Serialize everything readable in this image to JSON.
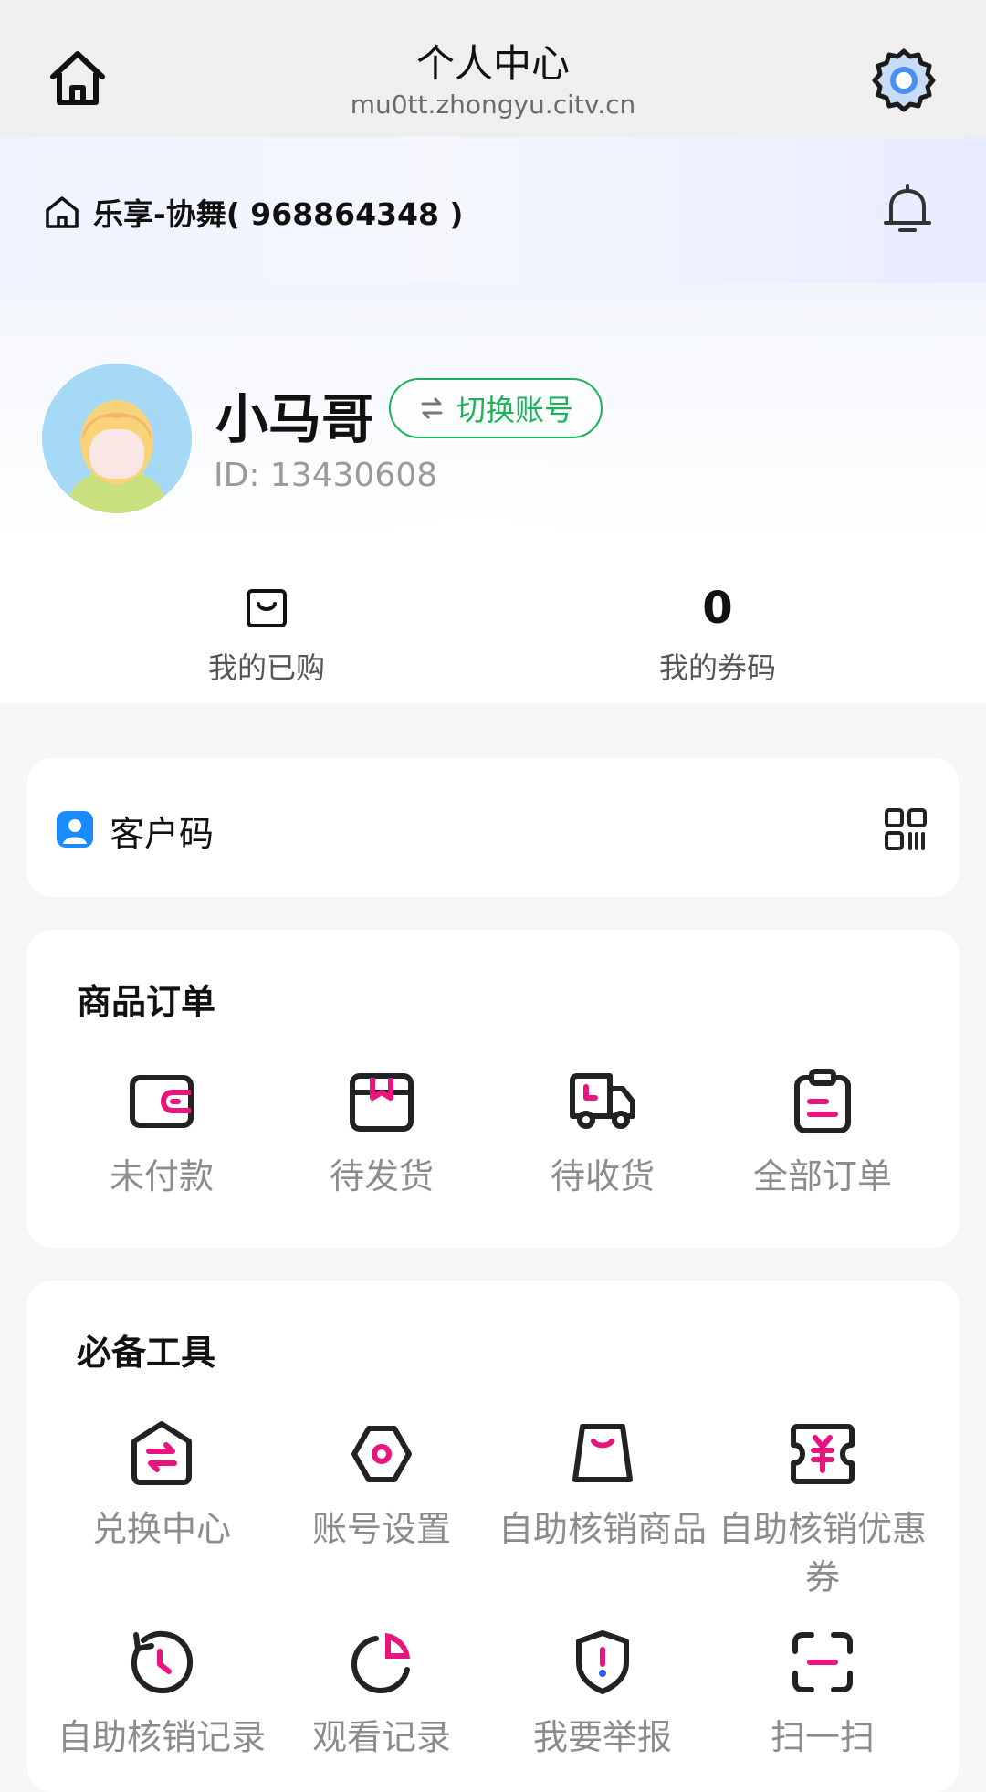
{
  "appbar": {
    "title": "个人中心",
    "url": "mu0tt.zhongyu.citv.cn"
  },
  "store": {
    "label": "乐享-协舞( 968864348 )"
  },
  "profile": {
    "name": "小马哥",
    "switch_label": "切换账号",
    "id_text": "ID: 13430608"
  },
  "stats": [
    {
      "value": "",
      "label": "我的已购",
      "icon": "bag-icon"
    },
    {
      "value": "0",
      "label": "我的券码"
    }
  ],
  "customer_code": {
    "label": "客户码"
  },
  "orders": {
    "title": "商品订单",
    "items": [
      {
        "label": "未付款",
        "icon": "wallet-icon"
      },
      {
        "label": "待发货",
        "icon": "box-icon"
      },
      {
        "label": "待收货",
        "icon": "truck-icon"
      },
      {
        "label": "全部订单",
        "icon": "clipboard-icon"
      }
    ]
  },
  "tools": {
    "title": "必备工具",
    "items": [
      {
        "label": "兑换中心",
        "icon": "exchange-icon"
      },
      {
        "label": "账号设置",
        "icon": "hexagon-settings-icon"
      },
      {
        "label": "自助核销商品",
        "icon": "shopping-bag-icon"
      },
      {
        "label": "自助核销优惠券",
        "icon": "coupon-icon"
      },
      {
        "label": "自助核销记录",
        "icon": "clock-history-icon"
      },
      {
        "label": "观看记录",
        "icon": "pie-chart-icon"
      },
      {
        "label": "我要举报",
        "icon": "shield-alert-icon"
      },
      {
        "label": "扫一扫",
        "icon": "scan-icon"
      }
    ]
  },
  "colors": {
    "accent": "#e8157f",
    "green": "#19b35a",
    "icon_dark": "#222222"
  }
}
